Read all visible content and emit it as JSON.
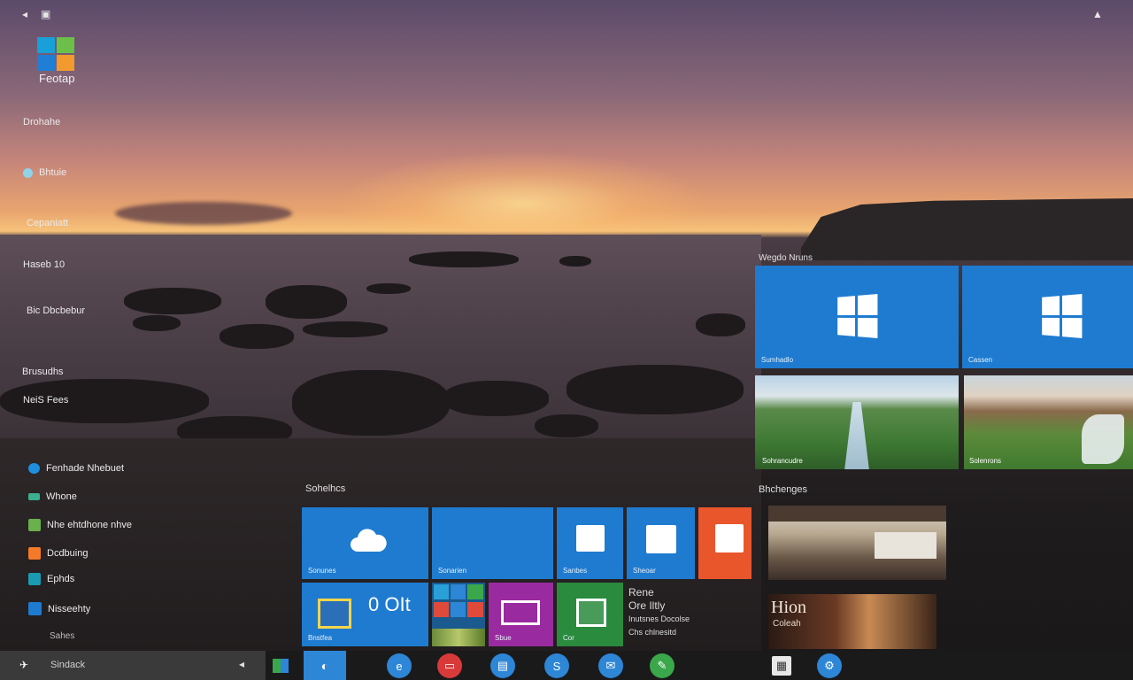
{
  "desktop": {
    "top_left_icons": [
      "◂",
      "▣"
    ],
    "top_right_icon": "▲",
    "app_label": "Feotap",
    "logo_colors": [
      "#1aa0d8",
      "#6cc04a",
      "#1f7ed6",
      "#f29a2e"
    ]
  },
  "sidebar": {
    "items": [
      {
        "label": "Drohahe",
        "icon": null
      },
      {
        "label": "Bhtuie",
        "icon": "circle-icon",
        "color": "#8fd3ea"
      },
      {
        "label": "Cepaniatt",
        "icon": null
      },
      {
        "label": "Haseb 10",
        "icon": null
      },
      {
        "label": "Bic Dbcbebur",
        "icon": null
      },
      {
        "label": "Brusudhs",
        "icon": null
      },
      {
        "label": "NeiS Fees",
        "icon": null
      },
      {
        "label": "Fenhade Nhebuet",
        "icon": "edge-icon",
        "color": "#1e8fe0"
      },
      {
        "label": "Whone",
        "icon": "window-icon",
        "color": "#3bb08f"
      },
      {
        "label": "Nhe ehtdhone nhve",
        "icon": "tiles-icon",
        "color": "#6ab04c"
      },
      {
        "label": "Dcdbuing",
        "icon": "orange-square-icon",
        "color": "#f47a2a"
      },
      {
        "label": "Ephds",
        "icon": "teal-square-icon",
        "color": "#1a9bb3"
      },
      {
        "label": "Nisseehty",
        "icon": "blue-square-icon",
        "color": "#1e7bd0"
      },
      {
        "label": "Sahes",
        "icon": null
      }
    ]
  },
  "groups": {
    "upper_label": "Wegdo Nruns",
    "left_label": "Sohelhcs",
    "right_label": "Bhchenges"
  },
  "tiles": {
    "windows_a": "Sumhadlo",
    "windows_b": "Cassen",
    "photo_a": "Sohrancudre",
    "photo_b": "Solenrons",
    "cloud": "Sonunes",
    "blank": "Sonarien",
    "store_a": "Sanbes",
    "store_b": "Sheoar",
    "orange": "",
    "clock_title": "0 OIt",
    "clock_sub": "Bnstfea",
    "purple": "Sbue",
    "green": "Cor",
    "text_line1": "Rene",
    "text_line2": "Ore Iltly",
    "text_line3": "Inutsnes Docolse",
    "text_line4": "Chs chlnesitd",
    "photo_c": "",
    "photo_d_title": "Hion",
    "photo_d_sub": "Coleah"
  },
  "taskbar": {
    "search_text": "Sindack",
    "back_glyph": "◂",
    "buttons": [
      {
        "name": "edge",
        "color": "#2d86d6",
        "glyph": "e"
      },
      {
        "name": "red-app",
        "color": "#d83a3a",
        "glyph": "▭"
      },
      {
        "name": "blue-app",
        "color": "#2d86d6",
        "glyph": "▤"
      },
      {
        "name": "steam",
        "color": "#2d86d6",
        "glyph": "S"
      },
      {
        "name": "mail",
        "color": "#2d86d6",
        "glyph": "✉"
      },
      {
        "name": "green-app",
        "color": "#3aa84a",
        "glyph": "✎"
      },
      {
        "name": "notes",
        "color": "#e8e8e8",
        "glyph": "▦"
      },
      {
        "name": "settings",
        "color": "#2d86d6",
        "glyph": "⚙"
      }
    ]
  }
}
